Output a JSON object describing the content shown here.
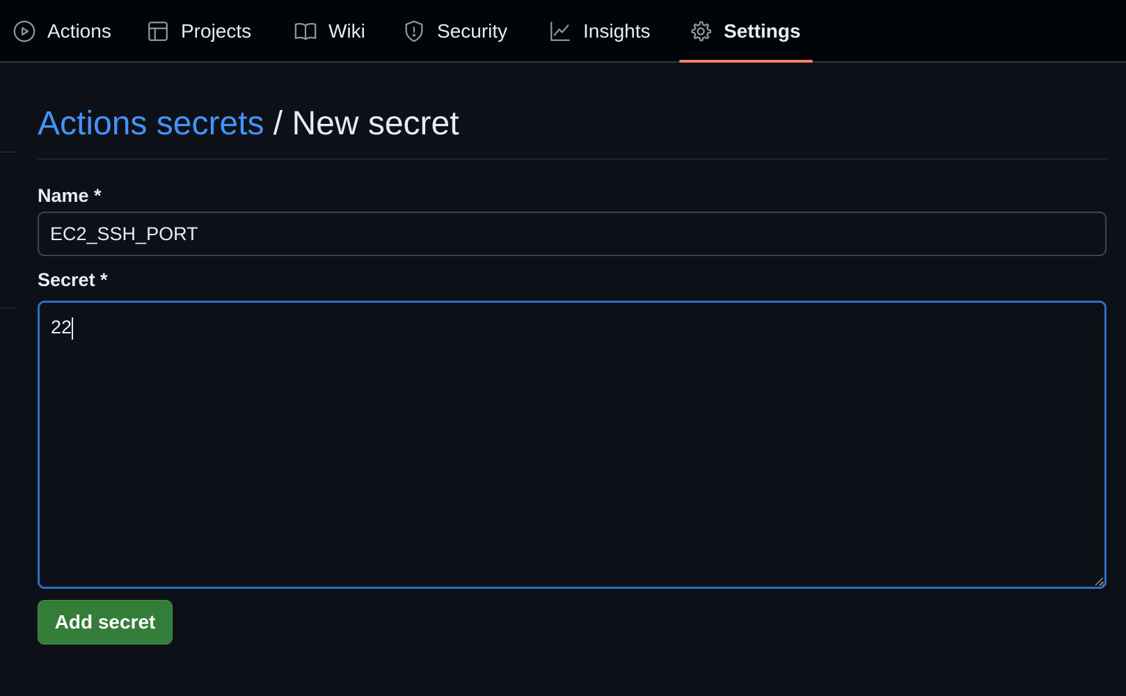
{
  "nav": {
    "items": [
      {
        "label": "Actions",
        "icon": "play-icon"
      },
      {
        "label": "Projects",
        "icon": "table-icon"
      },
      {
        "label": "Wiki",
        "icon": "book-icon"
      },
      {
        "label": "Security",
        "icon": "shield-icon"
      },
      {
        "label": "Insights",
        "icon": "graph-icon"
      },
      {
        "label": "Settings",
        "icon": "gear-icon",
        "active": true
      }
    ],
    "active_underline_color": "#f78166"
  },
  "breadcrumb": {
    "link_label": "Actions secrets",
    "separator": "/",
    "current": "New secret"
  },
  "form": {
    "name_label": "Name *",
    "name_value": "EC2_SSH_PORT",
    "secret_label": "Secret *",
    "secret_value": "22",
    "submit_label": "Add secret"
  },
  "colors": {
    "background": "#0d1117",
    "nav_background": "#010409",
    "link": "#4493f8",
    "focus_border": "#316dca",
    "button": "#347d39"
  }
}
